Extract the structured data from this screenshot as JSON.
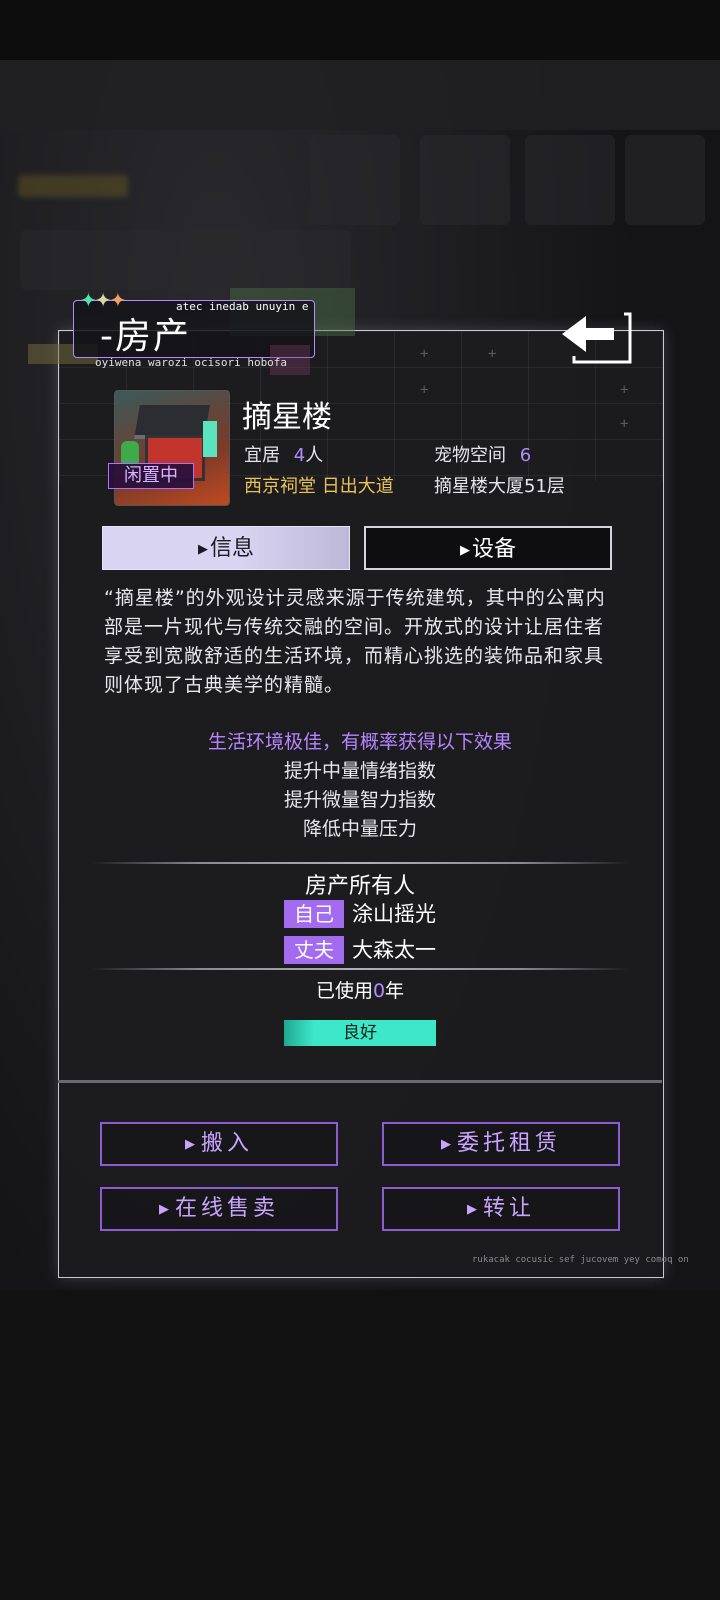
{
  "header": {
    "title": "-房产",
    "sub_top": "atec inedab unuyin e",
    "sub_bottom": "oyiwena warozi ocisori hobofa"
  },
  "property": {
    "name": "摘星楼",
    "status_badge": "闲置中",
    "livable_label": "宜居",
    "livable_value": "4",
    "livable_unit": "人",
    "pet_label": "宠物空间",
    "pet_value": "6",
    "location": "西京祠堂 日出大道",
    "address": "摘星楼大厦51层"
  },
  "tabs": [
    {
      "label": "信息",
      "active": true
    },
    {
      "label": "设备",
      "active": false
    }
  ],
  "description": "“摘星楼”的外观设计灵感来源于传统建筑，其中的公寓内部是一片现代与传统交融的空间。开放式的设计让居住者享受到宽敞舒适的生活环境，而精心挑选的装饰品和家具则体现了古典美学的精髓。",
  "effects": {
    "heading": "生活环境极佳，有概率获得以下效果",
    "items": [
      "提升中量情绪指数",
      "提升微量智力指数",
      "降低中量压力"
    ]
  },
  "owners": {
    "heading": "房产所有人",
    "list": [
      {
        "role": "自己",
        "name": "涂山摇光"
      },
      {
        "role": "丈夫",
        "name": "大森太一"
      }
    ]
  },
  "usage": {
    "prefix": "已使用",
    "years": "0",
    "suffix": "年"
  },
  "condition": "良好",
  "actions": [
    {
      "label": "搬入"
    },
    {
      "label": "委托租赁"
    },
    {
      "label": "在线售卖"
    },
    {
      "label": "转让"
    }
  ],
  "footer_code": "rukacak cocusic sef jucovem yey comoq on",
  "colors": {
    "accent_purple": "#a36cf0",
    "condition_teal": "#3de8c8",
    "gold_text": "#e8c25a"
  },
  "icons": {
    "back": "back-arrow-icon",
    "tab_marker": "triangle-right-icon"
  }
}
